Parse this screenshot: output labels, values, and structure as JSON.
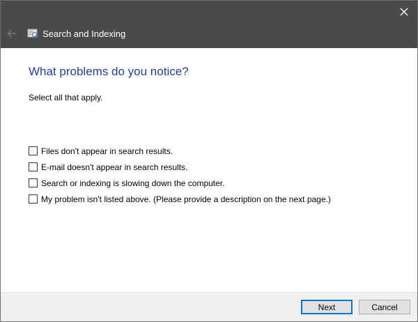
{
  "window": {
    "title": "Search and Indexing",
    "icons": {
      "close": "close-icon",
      "back": "arrow-left-icon",
      "app": "search-indexing-icon"
    },
    "colors": {
      "titlebar": "#4a4a4a",
      "heading": "#1f3f99",
      "accent": "#0078d7"
    }
  },
  "main": {
    "heading": "What problems do you notice?",
    "instruction": "Select all that apply.",
    "options": [
      {
        "label": "Files don't appear in search results.",
        "checked": false
      },
      {
        "label": "E-mail doesn't appear in search results.",
        "checked": false
      },
      {
        "label": "Search or indexing is slowing down the computer.",
        "checked": false
      },
      {
        "label": "My problem isn't listed above. (Please provide a description on the next page.)",
        "checked": false
      }
    ]
  },
  "footer": {
    "next_label": "Next",
    "cancel_label": "Cancel"
  }
}
